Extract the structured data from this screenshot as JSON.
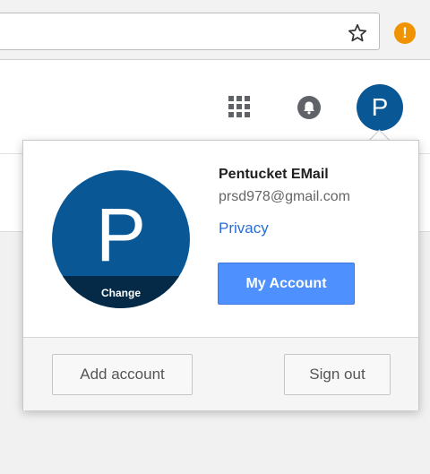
{
  "browser": {
    "star_icon": "star-outline-icon",
    "alert_icon": "exclamation-icon",
    "alert_symbol": "!",
    "alert_color": "#f09300"
  },
  "header": {
    "apps_icon": "apps-grid-icon",
    "notifications_icon": "bell-icon",
    "avatar_initial": "P",
    "avatar_color": "#0a5796"
  },
  "account_popup": {
    "avatar_initial": "P",
    "change_label": "Change",
    "name": "Pentucket EMail",
    "email": "prsd978@gmail.com",
    "privacy_label": "Privacy",
    "my_account_label": "My Account",
    "add_account_label": "Add account",
    "sign_out_label": "Sign out",
    "accent_color": "#4d90fe",
    "link_color": "#2a6ed6"
  }
}
